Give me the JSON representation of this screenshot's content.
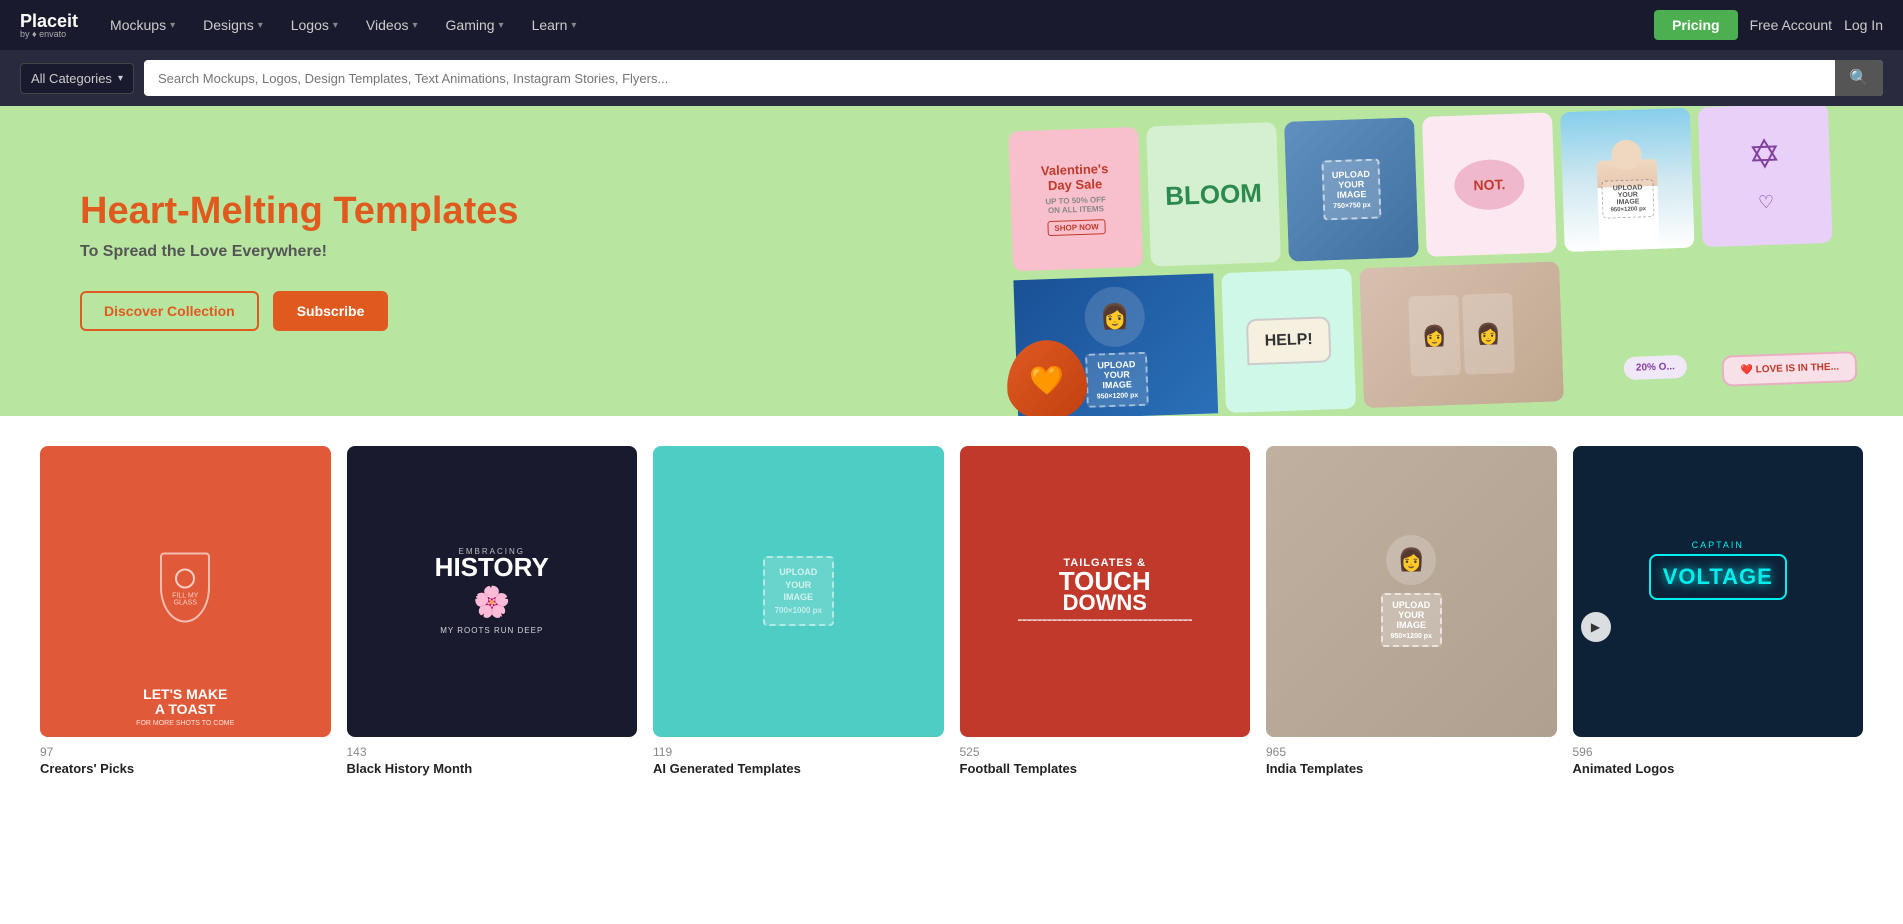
{
  "nav": {
    "logo": {
      "main": "Placeit",
      "sub": "by ♦ envato"
    },
    "items": [
      {
        "label": "Mockups",
        "has_dropdown": true
      },
      {
        "label": "Designs",
        "has_dropdown": true
      },
      {
        "label": "Logos",
        "has_dropdown": true
      },
      {
        "label": "Videos",
        "has_dropdown": true
      },
      {
        "label": "Gaming",
        "has_dropdown": true
      },
      {
        "label": "Learn",
        "has_dropdown": true
      }
    ],
    "pricing_label": "Pricing",
    "free_account_label": "Free Account",
    "log_in_label": "Log In"
  },
  "search": {
    "category_label": "All Categories",
    "placeholder": "Search Mockups, Logos, Design Templates, Text Animations, Instagram Stories, Flyers...",
    "search_icon": "🔍"
  },
  "hero": {
    "title": "Heart-Melting Templates",
    "subtitle": "To Spread the Love Everywhere!",
    "discover_btn": "Discover Collection",
    "subscribe_btn": "Subscribe"
  },
  "collections": [
    {
      "id": "creators-picks",
      "count": "97",
      "name": "Creators' Picks",
      "bg": "red",
      "art_lines": [
        "LET'S MAKE",
        "A TOAST"
      ],
      "art_sub": "FOR MORE SHOTS TO COME"
    },
    {
      "id": "black-history-month",
      "count": "143",
      "name": "Black History Month",
      "bg": "dark",
      "art_lines": [
        "EMBRACING",
        "HISTORY"
      ],
      "art_sub": "MY ROOTS RUN DEEP"
    },
    {
      "id": "ai-generated-templates",
      "count": "119",
      "name": "AI Generated Templates",
      "bg": "teal",
      "art_lines": [
        "UPLOAD",
        "YOUR",
        "IMAGE"
      ],
      "art_sub": "700×1000 px"
    },
    {
      "id": "football-templates",
      "count": "525",
      "name": "Football Templates",
      "bg": "crimson",
      "art_lines": [
        "TAILGATES &",
        "TOUCH",
        "DOWNS"
      ]
    },
    {
      "id": "india-templates",
      "count": "965",
      "name": "India Templates",
      "bg": "light",
      "art_lines": [
        "UPLOAD",
        "YOUR",
        "IMAGE"
      ],
      "art_sub": "950×1200 px"
    },
    {
      "id": "animated-logos",
      "count": "596",
      "name": "Animated Logos",
      "bg": "darkblue",
      "art_lines": [
        "CAPTAIN",
        "VOLTAGE"
      ],
      "is_video": true
    }
  ]
}
